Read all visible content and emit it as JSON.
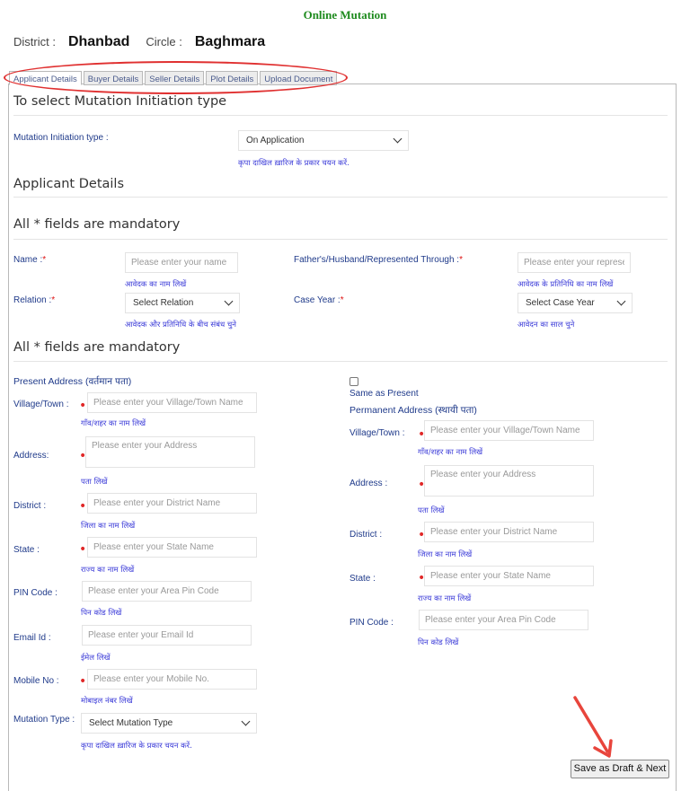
{
  "page": {
    "title": "Online Mutation",
    "district_label": "District :",
    "district_value": "Dhanbad",
    "circle_label": "Circle :",
    "circle_value": "Baghmara"
  },
  "tabs": [
    {
      "label": "Applicant Details",
      "active": true
    },
    {
      "label": "Buyer Details",
      "active": false
    },
    {
      "label": "Seller Details",
      "active": false
    },
    {
      "label": "Plot Details",
      "active": false
    },
    {
      "label": "Upload Document",
      "active": false
    }
  ],
  "initiation": {
    "section_title": "To select Mutation Initiation type",
    "label": "Mutation Initiation type :",
    "selected": "On Application",
    "hint": "कृपा दाखिल ख़ारिज के प्रकार चयन करें."
  },
  "applicant": {
    "section_title": "Applicant Details",
    "mandatory_note": "All * fields are mandatory",
    "name_label": "Name :",
    "name_placeholder": "Please enter your name",
    "name_hint": "आवेदक का नाम लिखें",
    "father_label": "Father's/Husband/Represented Through :",
    "father_placeholder": "Please enter your represen",
    "father_hint": "आवेदक के प्रतिनिधि का नाम लिखें",
    "relation_label": "Relation :",
    "relation_selected": "Select Relation",
    "relation_hint": "आवेदक और प्रतिनिधि के बीच संबंध चुने",
    "case_year_label": "Case Year :",
    "case_year_selected": "Select Case Year",
    "case_year_hint": "आवेदन का साल चुने",
    "required_mark": "*"
  },
  "address": {
    "mandatory_note": "All * fields are mandatory",
    "present_title": "Present Address (वर्तमान पता)",
    "same_as_present": "Same as Present",
    "permanent_title": "Permanent Address (स्थायी पता)",
    "village_label": "Village/Town :",
    "village_placeholder": "Please enter your Village/Town Name",
    "village_hint": "गाँव/शहर का नाम लिखें",
    "address_label": "Address:",
    "address_label_perm": "Address :",
    "address_placeholder": "Please enter your Address",
    "address_hint": "पता लिखें",
    "district_label": "District :",
    "district_placeholder": "Please enter your District Name",
    "district_hint": "जिला का नाम लिखें",
    "state_label": "State :",
    "state_placeholder": "Please enter your State Name",
    "state_hint": "राज्य का नाम लिखें",
    "pin_label": "PIN Code :",
    "pin_placeholder": "Please enter your Area Pin Code",
    "pin_hint": "पिन कोड लिखें",
    "email_label": "Email Id :",
    "email_placeholder": "Please enter your Email Id",
    "email_hint": "ईमेल लिखें",
    "mobile_label": "Mobile No :",
    "mobile_placeholder": "Please enter your Mobile No.",
    "mobile_hint": "मोबाइल नंबर लिखें",
    "mutation_type_label": "Mutation Type :",
    "mutation_type_selected": "Select Mutation Type",
    "mutation_type_hint": "कृपा दाखिल ख़ारिज के प्रकार चयन करें."
  },
  "actions": {
    "save_label": "Save as Draft & Next"
  },
  "colors": {
    "title_green": "#1e8b1e",
    "label_blue": "#1f3a8a",
    "hint_blue": "#3b3bd8",
    "required_red": "#d11111",
    "annotation_red": "#e03030"
  }
}
